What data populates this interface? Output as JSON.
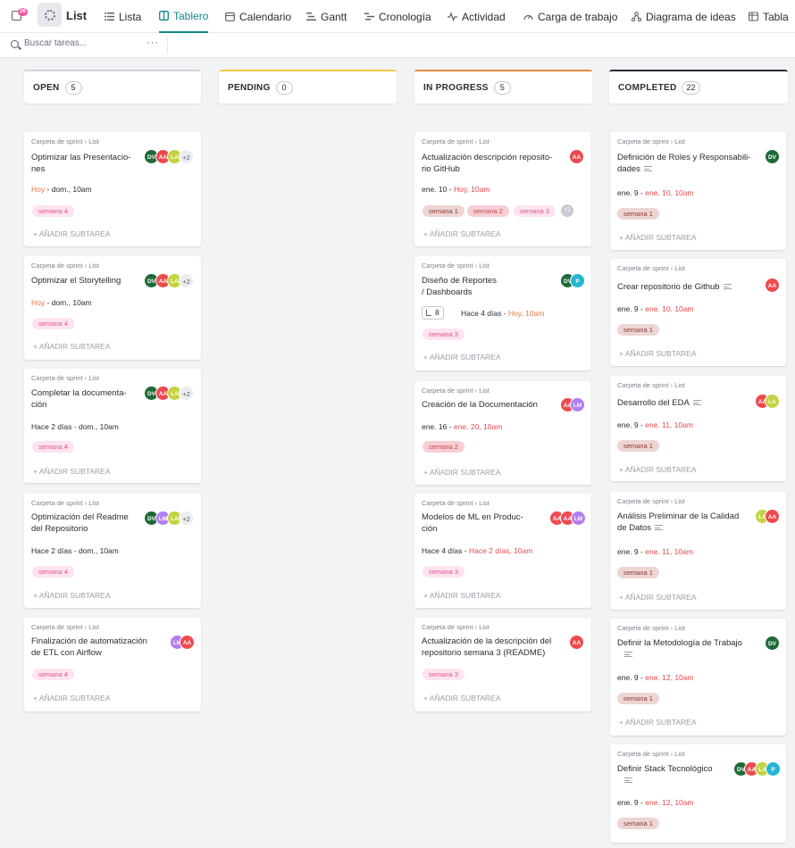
{
  "topbar": {
    "inbox_badge": "26",
    "list_name": "List",
    "tabs": [
      {
        "label": "Lista",
        "icon": "list-icon"
      },
      {
        "label": "Tablero",
        "icon": "board-icon"
      },
      {
        "label": "Calendario",
        "icon": "calendar-icon"
      },
      {
        "label": "Gantt",
        "icon": "gantt-icon"
      },
      {
        "label": "Cronología",
        "icon": "timeline-icon"
      },
      {
        "label": "Actividad",
        "icon": "activity-icon"
      },
      {
        "label": "Carga de trabajo",
        "icon": "workload-icon"
      },
      {
        "label": "Diagrama de ideas",
        "icon": "mindmap-icon"
      },
      {
        "label": "Tabla",
        "icon": "table-icon"
      }
    ],
    "active_tab": "Tablero",
    "accent_color": "#0f8a8a"
  },
  "search": {
    "placeholder": "Buscar tareas...",
    "value": "",
    "more": "···"
  },
  "columns": [
    {
      "name": "OPEN",
      "count": "5",
      "color": "#d0d3d9"
    },
    {
      "name": "PENDING",
      "count": "0",
      "color": "#f2c94c"
    },
    {
      "name": "IN PROGRESS",
      "count": "5",
      "color": "#e8893c"
    },
    {
      "name": "COMPLETED",
      "count": "22",
      "color": "#292d34"
    }
  ],
  "common": {
    "crumb_folder": "Carpeta de sprint",
    "crumb_list": "List",
    "add_subtask": "+ AÑADIR SUBTAREA",
    "sep": "-"
  },
  "open_cards": [
    {
      "title_l1": "Optimizar las Presentacio-",
      "title_l2": "nes",
      "start": "Hoy",
      "due": "dom., 10am",
      "tag": "semana 4",
      "plus": "+2"
    },
    {
      "title_l1": "Optimizar el Storytelling",
      "title_l2": "",
      "start": "Hoy",
      "due": "dom., 10am",
      "tag": "semana 4",
      "plus": "+2"
    },
    {
      "title_l1": "Completar la documenta-",
      "title_l2": "ción",
      "start": "Hace 2 días",
      "due": "dom., 10am",
      "tag": "semana 4",
      "plus": "+2"
    },
    {
      "title_l1": "Optimización del Readme",
      "title_l2": "del Repositorio",
      "start": "Hace 2 días",
      "due": "dom., 10am",
      "tag": "semana 4",
      "plus": "+2"
    },
    {
      "title_l1": "Finalización de automatización",
      "title_l2": "de ETL con Airflow",
      "start": "",
      "due": "",
      "tag": "semana 4",
      "plus": ""
    }
  ],
  "progress_cards": [
    {
      "title_l1": "Actualización descripción reposito-",
      "title_l2": "rio GitHub",
      "start": "ene. 10",
      "due": "Hoy, 10am",
      "tags": [
        "semana 1",
        "semana 2",
        "semana 3"
      ],
      "plus": "+1"
    },
    {
      "title_l1": "Diseño de Reportes",
      "title_l2": "/ Dashboards",
      "subtasks": "8",
      "start": "Hace 4 días",
      "due": "Hoy, 10am",
      "tag": "semana 3"
    },
    {
      "title_l1": "Creación de la Documentación",
      "title_l2": "",
      "start": "ene. 16",
      "due": "ene. 20, 10am",
      "tag": "semana 2"
    },
    {
      "title_l1": "Modelos de ML en Produc-",
      "title_l2": "ción",
      "start": "Hace 4 días",
      "due": "Hace 2 días, 10am",
      "tag": "semana 3"
    },
    {
      "title_l1": "Actualización de la descripción del",
      "title_l2": "repositorio semana 3 (README)",
      "start": "",
      "due": "",
      "tag": "semana 3"
    }
  ],
  "completed_cards": [
    {
      "title_l1": "Definición de Roles y Responsabili-",
      "title_l2": "dades",
      "start": "ene. 9",
      "due": "ene. 10, 10am",
      "tag": "semana 1"
    },
    {
      "title_l1": "Crear repositorio de Github",
      "title_l2": "",
      "start": "ene. 9",
      "due": "ene. 10, 10am",
      "tag": "semana 1"
    },
    {
      "title_l1": "Desarrollo del EDA",
      "title_l2": "",
      "start": "ene. 9",
      "due": "ene. 11, 10am",
      "tag": "semana 1"
    },
    {
      "title_l1": "Análisis Preliminar de la Calidad",
      "title_l2": "de Datos",
      "start": "ene. 9",
      "due": "ene. 11, 10am",
      "tag": "semana 1"
    },
    {
      "title_l1": "Definir la Metodología de Trabajo",
      "title_l2": "",
      "start": "ene. 9",
      "due": "ene. 12, 10am",
      "tag": "semana 1"
    },
    {
      "title_l1": "Definir Stack Tecnológico",
      "title_l2": "",
      "start": "ene. 9",
      "due": "ene. 12, 10am",
      "tag": "semana 1"
    }
  ],
  "avatars": {
    "dv": "DV",
    "aa": "AA",
    "la": "LA",
    "lm": "LM",
    "p": "P",
    "p_full": "AA"
  }
}
